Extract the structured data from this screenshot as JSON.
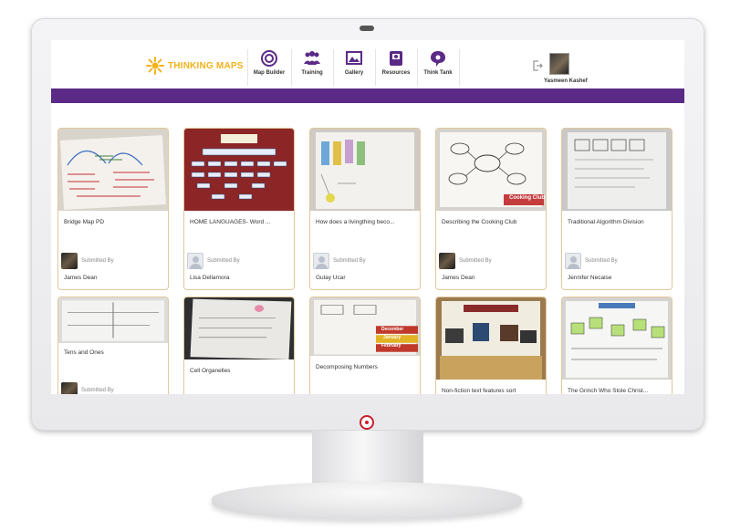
{
  "brand": {
    "name": "THINKING MAPS",
    "accent": "#5b2a86",
    "logo_color": "#f2b21a"
  },
  "nav": [
    {
      "label": "Map Builder",
      "icon": "target-icon"
    },
    {
      "label": "Training",
      "icon": "people-icon"
    },
    {
      "label": "Gallery",
      "icon": "gallery-icon"
    },
    {
      "label": "Resources",
      "icon": "resources-icon"
    },
    {
      "label": "Think Tank",
      "icon": "speech-bubble-icon"
    }
  ],
  "user": {
    "name": "Yasmeen Kashef"
  },
  "cards": [
    {
      "title": "Bridge Map PD",
      "submitted_label": "Submitted By",
      "author": "James Dean",
      "avatar": "photo"
    },
    {
      "title": "HOME LANGUAGES- Word ...",
      "submitted_label": "Submitted By",
      "author": "Lisa Dellamora",
      "avatar": "blank"
    },
    {
      "title": "How does a livingthing beco...",
      "submitted_label": "Submitted By",
      "author": "Gulay Ucar",
      "avatar": "blank"
    },
    {
      "title": "Describing the Cooking Club",
      "submitted_label": "Submitted By",
      "author": "James Dean",
      "avatar": "photo"
    },
    {
      "title": "Traditional Algorithm Division",
      "submitted_label": "Submitted By",
      "author": "Jennifer Necaise",
      "avatar": "blank"
    },
    {
      "title": "Tens and Ones",
      "submitted_label": "Submitted By",
      "author": "",
      "avatar": "photo"
    },
    {
      "title": "Cell Organelles",
      "submitted_label": "",
      "author": "",
      "avatar": "none"
    },
    {
      "title": "Decomposing Numbers",
      "submitted_label": "",
      "author": "",
      "avatar": "none"
    },
    {
      "title": "Non-fiction text features sort",
      "submitted_label": "",
      "author": "",
      "avatar": "none"
    },
    {
      "title": "The Grinch Who Stole Christ...",
      "submitted_label": "",
      "author": "",
      "avatar": "none"
    }
  ],
  "thumb_texts": {
    "cooking_club": "Cooking Club",
    "months": [
      "December",
      "January",
      "February"
    ]
  }
}
